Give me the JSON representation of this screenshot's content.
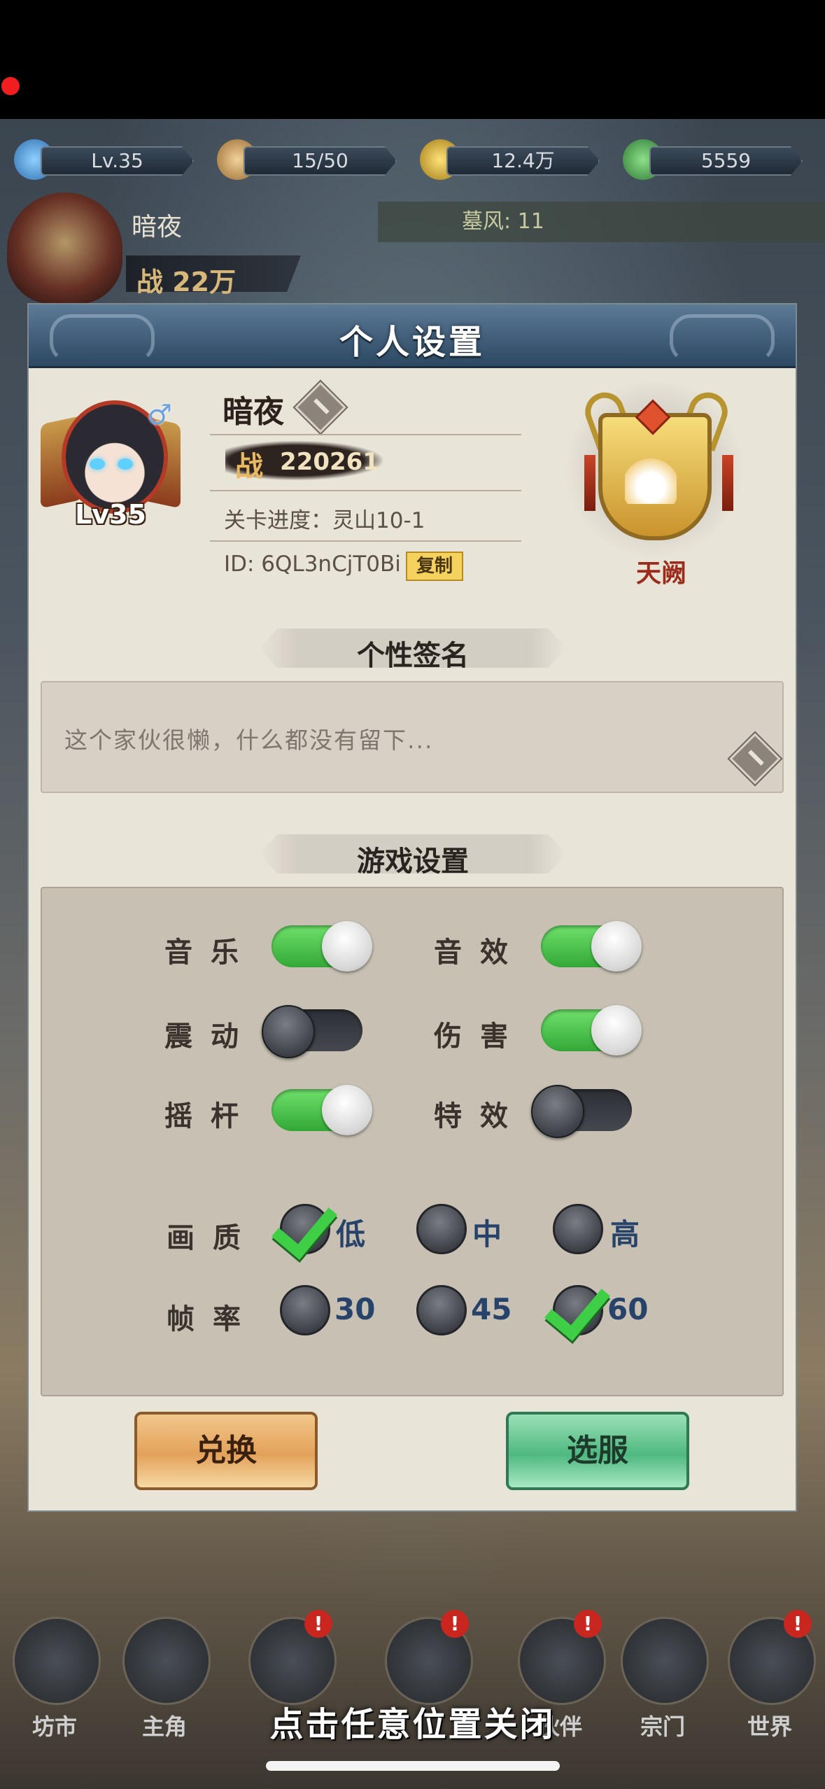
{
  "resources": [
    {
      "name": "level",
      "value": "Lv.35",
      "color": "#5aa3e0"
    },
    {
      "name": "stamina",
      "value": "15/50",
      "color": "#c79a5a"
    },
    {
      "name": "coins",
      "value": "12.4万",
      "color": "#d8b23a"
    },
    {
      "name": "jade",
      "value": "5559",
      "color": "#3e9a48"
    }
  ],
  "player_bar": {
    "name": "暗夜",
    "power": "战 22万",
    "ticker": "墓风: 11"
  },
  "dialog": {
    "title": "个人设置",
    "profile": {
      "name": "暗夜",
      "level": "Lv35",
      "gender_icon": "♂",
      "power_label": "战",
      "power_value": "220261",
      "stage_progress": "关卡进度：灵山10-1",
      "id_text": "ID: 6QL3nCjT0Bi",
      "copy_label": "复制",
      "rank_label": "天阙"
    },
    "signature": {
      "heading": "个性签名",
      "text": "这个家伙很懒，什么都没有留下..."
    },
    "game_settings": {
      "heading": "游戏设置",
      "toggles": [
        {
          "label": "音乐",
          "on": true
        },
        {
          "label": "音效",
          "on": true
        },
        {
          "label": "震动",
          "on": false
        },
        {
          "label": "伤害",
          "on": true
        },
        {
          "label": "摇杆",
          "on": true
        },
        {
          "label": "特效",
          "on": false
        }
      ],
      "quality": {
        "label": "画质",
        "options": [
          "低",
          "中",
          "高"
        ],
        "selected": "低"
      },
      "framerate": {
        "label": "帧率",
        "options": [
          "30",
          "45",
          "60"
        ],
        "selected": "60"
      }
    },
    "buttons": {
      "redeem": "兑换",
      "select_server": "选服"
    }
  },
  "bottom_nav": [
    {
      "label": "坊市",
      "badge": ""
    },
    {
      "label": "主角",
      "badge": ""
    },
    {
      "label": "",
      "badge": "!"
    },
    {
      "label": "",
      "badge": "!"
    },
    {
      "label": "伙伴",
      "badge": "!"
    },
    {
      "label": "宗门",
      "badge": ""
    },
    {
      "label": "世界",
      "badge": "!"
    }
  ],
  "close_hint": "点击任意位置关闭"
}
